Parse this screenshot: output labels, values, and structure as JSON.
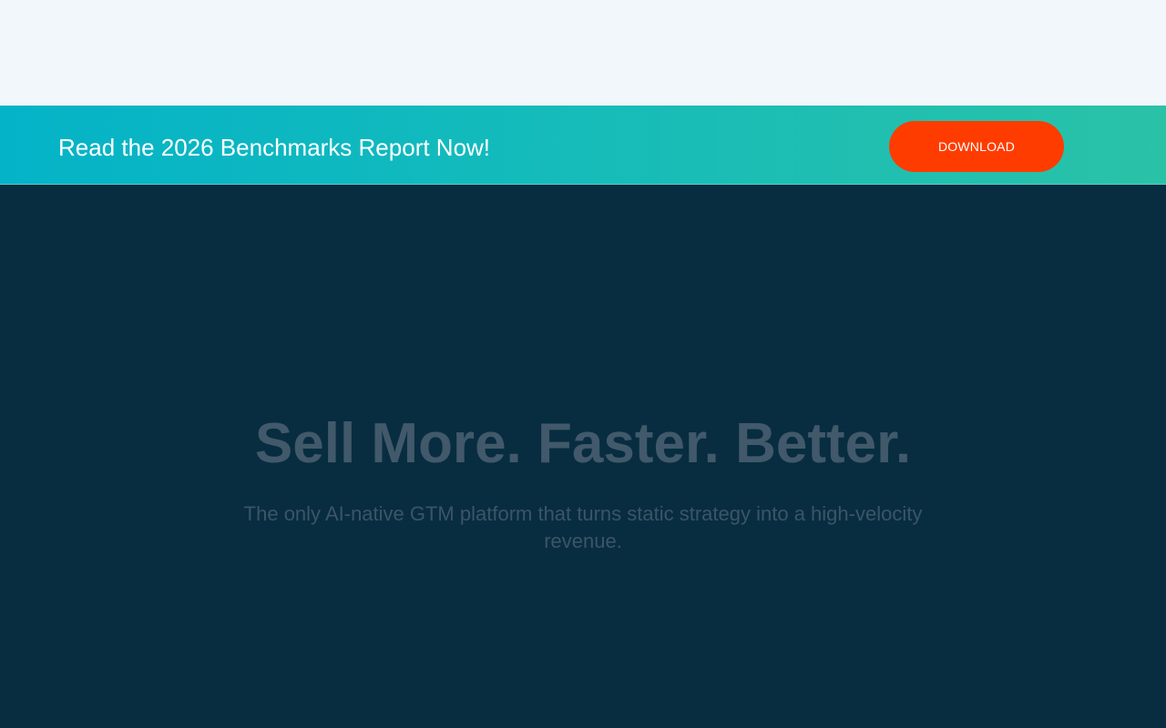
{
  "banner": {
    "text": "Read the 2026 Benchmarks Report Now!",
    "button_label": "DOWNLOAD"
  },
  "hero": {
    "title": "Sell More. Faster. Better.",
    "subtitle": "The only AI-native GTM platform that turns static strategy into a high-velocity revenue."
  },
  "colors": {
    "header_background": "#f1f7fb",
    "banner_gradient_start": "#04b3c8",
    "banner_gradient_end": "#2ac2a7",
    "button_background": "#ff3c00",
    "hero_background": "#082d40"
  }
}
